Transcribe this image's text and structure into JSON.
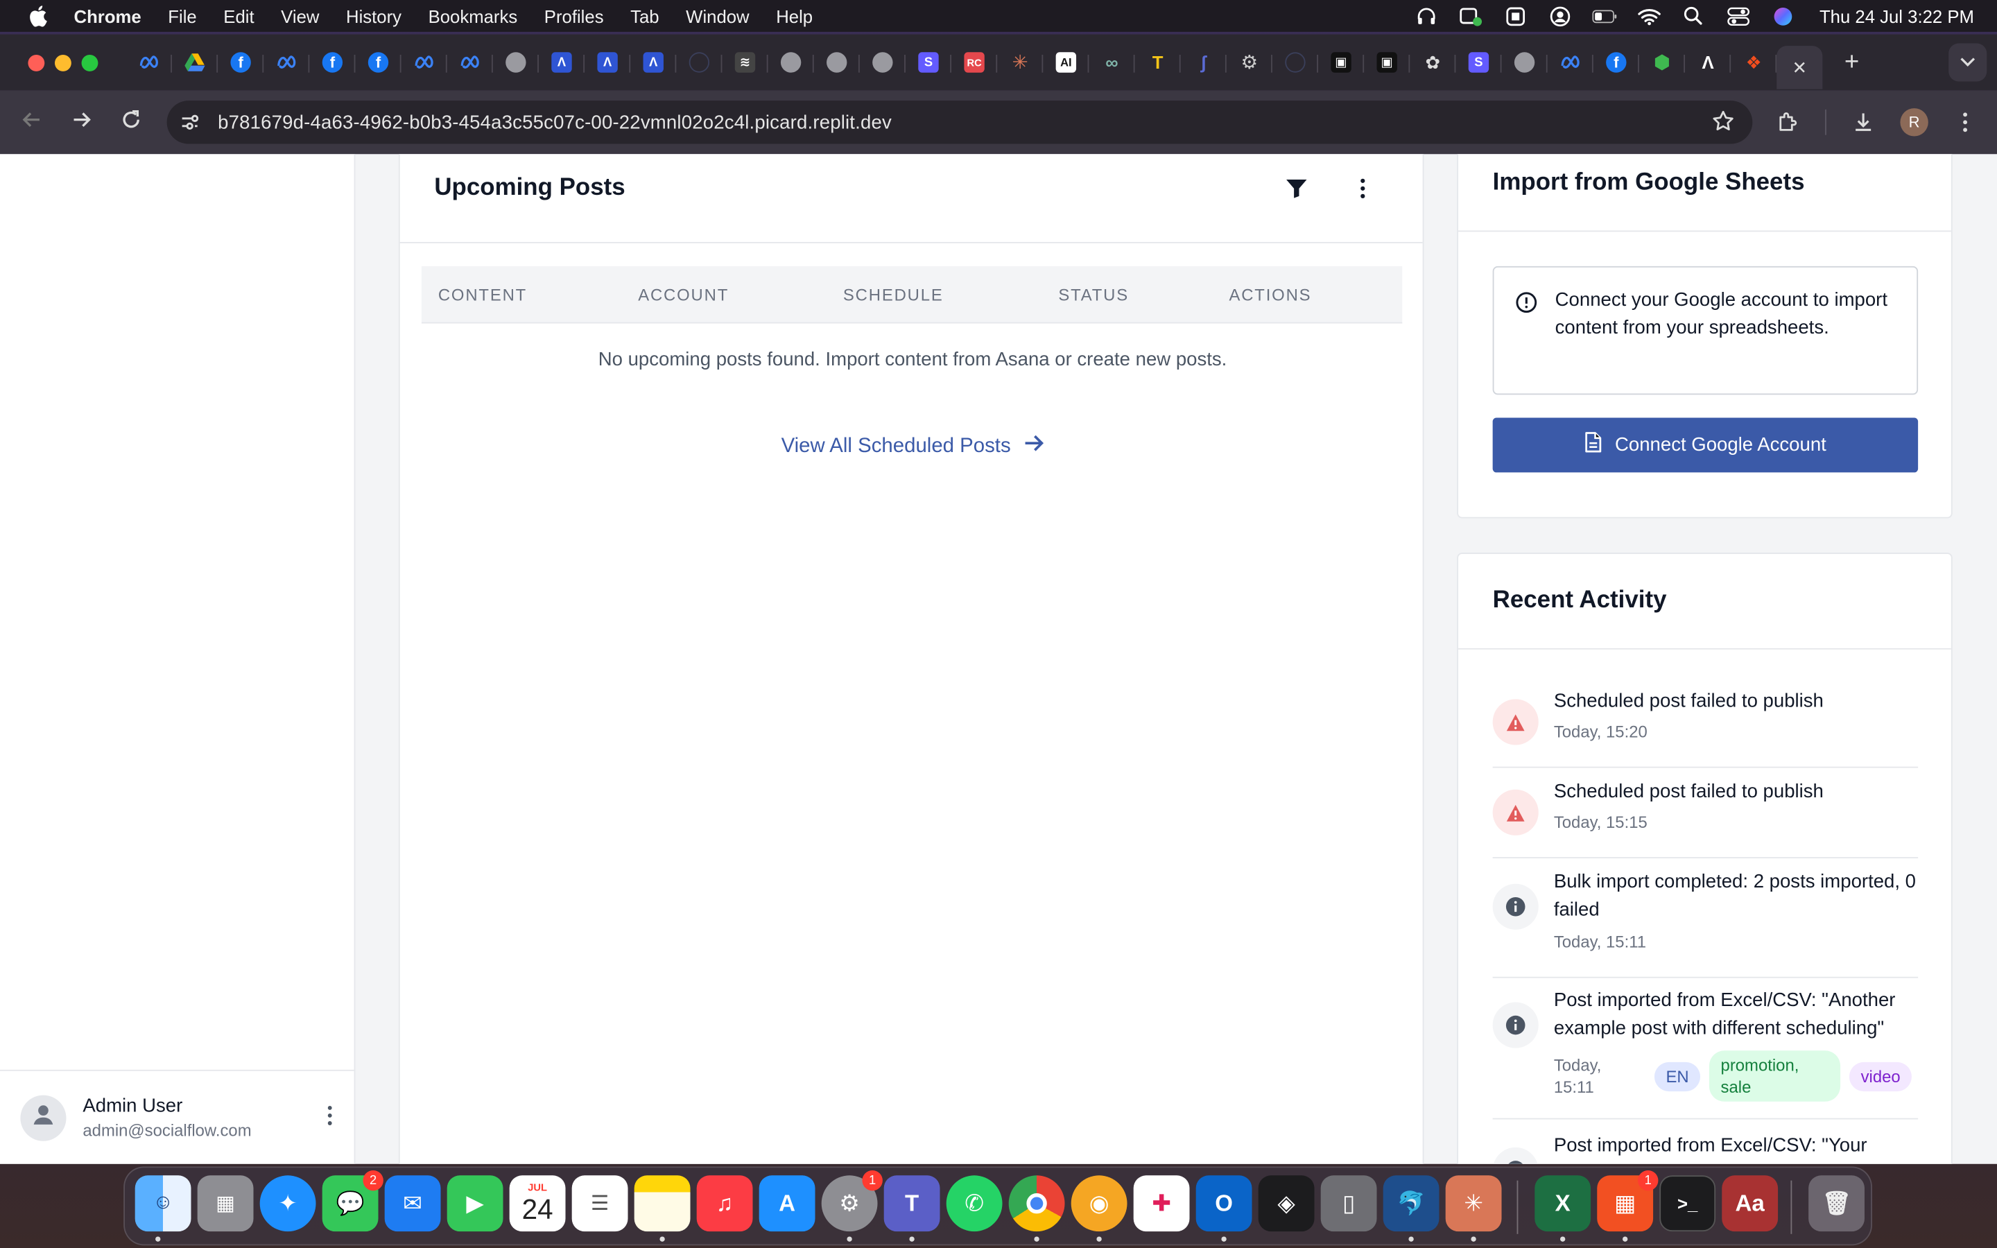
{
  "menubar": {
    "app_name": "Chrome",
    "items": [
      "File",
      "Edit",
      "View",
      "History",
      "Bookmarks",
      "Profiles",
      "Tab",
      "Window",
      "Help"
    ],
    "clock": "Thu 24 Jul  3:22 PM"
  },
  "browser": {
    "url": "b781679d-4a63-4962-b0b3-454a3c55c07c-00-22vmnl02o2c4l.picard.replit.dev",
    "profile_initial": "R",
    "close_tab_glyph": "✕",
    "new_tab_glyph": "+"
  },
  "sidebar": {
    "user_name": "Admin User",
    "user_email": "admin@socialflow.com"
  },
  "upcoming_posts": {
    "title": "Upcoming Posts",
    "columns": [
      "CONTENT",
      "ACCOUNT",
      "SCHEDULE",
      "STATUS",
      "ACTIONS"
    ],
    "empty_message": "No upcoming posts found. Import content from Asana or create new posts.",
    "view_all_label": "View All Scheduled Posts"
  },
  "import_sheets": {
    "title": "Import from Google Sheets",
    "info_text": "Connect your Google account to import content from your spreadsheets.",
    "button_label": "Connect Google Account"
  },
  "recent_activity": {
    "title": "Recent Activity",
    "items": [
      {
        "type": "error",
        "text": "Scheduled post failed to publish",
        "time": "Today, 15:20"
      },
      {
        "type": "error",
        "text": "Scheduled post failed to publish",
        "time": "Today, 15:15"
      },
      {
        "type": "info",
        "text": "Bulk import completed: 2 posts imported, 0 failed",
        "time": "Today, 15:11"
      },
      {
        "type": "info",
        "text": "Post imported from Excel/CSV: \"Another example post with different scheduling\"",
        "time": "Today, 15:11",
        "tags": [
          "EN",
          "promotion, sale",
          "video"
        ]
      },
      {
        "type": "info",
        "text": "Post imported from Excel/CSV: \"Your"
      }
    ]
  },
  "dock": {
    "calendar_month": "JUL",
    "calendar_day": "24",
    "messages_badge": "2",
    "settings_badge": "1",
    "office_badge": "1",
    "dictionary_label": "Aa"
  },
  "colors": {
    "accent": "#3b5aa8",
    "error": "#e25c5c",
    "page_bg": "#f3f4f6"
  }
}
